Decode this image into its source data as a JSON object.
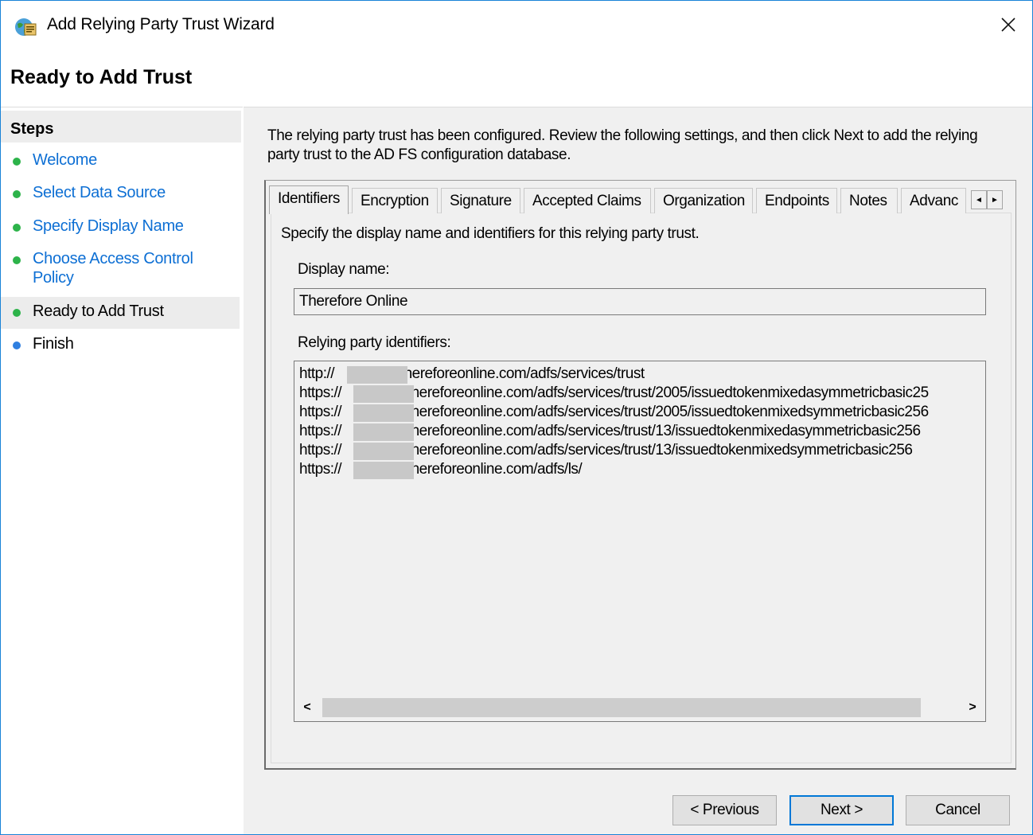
{
  "window": {
    "title": "Add Relying Party Trust Wizard",
    "close_glyph": "✕"
  },
  "header": {
    "page_title": "Ready to Add Trust"
  },
  "steps": {
    "heading": "Steps",
    "items": [
      {
        "label": "Welcome",
        "state": "done"
      },
      {
        "label": "Select Data Source",
        "state": "done"
      },
      {
        "label": "Specify Display Name",
        "state": "done"
      },
      {
        "label": "Choose Access Control\nPolicy",
        "state": "done"
      },
      {
        "label": "Ready to Add Trust",
        "state": "current"
      },
      {
        "label": "Finish",
        "state": "pending"
      }
    ],
    "colors": {
      "done": "#2db34a",
      "current": "#2db34a",
      "pending": "#2f7fe0",
      "link": "#0d6fd4"
    }
  },
  "main": {
    "intro": "The relying party trust has been configured. Review the following settings, and then click Next to add the relying party trust to the AD FS configuration database.",
    "tabs": [
      {
        "label": "Identifiers",
        "active": true
      },
      {
        "label": "Encryption"
      },
      {
        "label": "Signature"
      },
      {
        "label": "Accepted Claims"
      },
      {
        "label": "Organization"
      },
      {
        "label": "Endpoints"
      },
      {
        "label": "Notes"
      },
      {
        "label": "Advanc"
      }
    ],
    "tab_scroll": {
      "left": "◄",
      "right": "►"
    },
    "identifiers_tab": {
      "description": "Specify the display name and identifiers for this relying party trust.",
      "display_name_label": "Display name:",
      "display_name_value": "Therefore Online",
      "identifiers_label": "Relying party identifiers:",
      "identifiers": [
        {
          "prefix": "http://",
          "suffix": ".thereforeonline.com/adfs/services/trust"
        },
        {
          "prefix": "https://",
          "suffix": ".thereforeonline.com/adfs/services/trust/2005/issuedtokenmixedasymmetricbasic25"
        },
        {
          "prefix": "https://",
          "suffix": ".thereforeonline.com/adfs/services/trust/2005/issuedtokenmixedsymmetricbasic256"
        },
        {
          "prefix": "https://",
          "suffix": ".thereforeonline.com/adfs/services/trust/13/issuedtokenmixedasymmetricbasic256"
        },
        {
          "prefix": "https://",
          "suffix": ".thereforeonline.com/adfs/services/trust/13/issuedtokenmixedsymmetricbasic256"
        },
        {
          "prefix": "https://",
          "suffix": ".thereforeonline.com/adfs/ls/"
        }
      ],
      "scroll_left": "<",
      "scroll_right": ">"
    }
  },
  "footer": {
    "previous_label": "< Previous",
    "next_label": "Next >",
    "cancel_label": "Cancel"
  }
}
